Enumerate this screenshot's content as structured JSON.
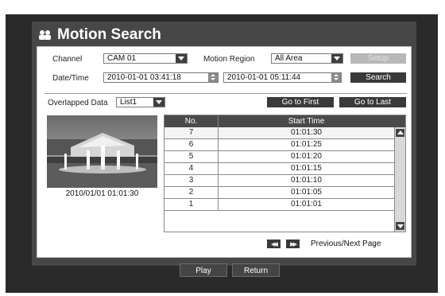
{
  "title": "Motion Search",
  "channel": {
    "label": "Channel",
    "value": "CAM 01"
  },
  "motion_region": {
    "label": "Motion Region",
    "value": "All Area"
  },
  "setup_label": "Setup",
  "datetime": {
    "label": "Date/Time",
    "start": "2010-01-01  03:41:18",
    "end": "2010-01-01  05:11:44"
  },
  "search_label": "Search",
  "overlapped": {
    "label": "Overlapped Data",
    "value": "List1"
  },
  "go_first_label": "Go to First",
  "go_last_label": "Go to Last",
  "thumbnail_time": "2010/01/01  01:01:30",
  "table": {
    "headers": [
      "No.",
      "Start Time"
    ],
    "rows": [
      {
        "no": "7",
        "time": "01:01:30"
      },
      {
        "no": "6",
        "time": "01:01:25"
      },
      {
        "no": "5",
        "time": "01:01:20"
      },
      {
        "no": "4",
        "time": "01:01:15"
      },
      {
        "no": "3",
        "time": "01:01:10"
      },
      {
        "no": "2",
        "time": "01:01:05"
      },
      {
        "no": "1",
        "time": "01:01:01"
      }
    ]
  },
  "pager_label": "Previous/Next Page",
  "play_label": "Play",
  "return_label": "Return",
  "icons": {
    "title": "users-icon",
    "dropdown": "chevron-down-icon",
    "spinner": "up-down-spinner-icon",
    "prev": "rewind-icon",
    "next": "fast-forward-icon"
  },
  "colors": {
    "frame": "#2a2a2a",
    "header_bg": "#4a4a4a",
    "button_bg": "#3a3a3a"
  }
}
